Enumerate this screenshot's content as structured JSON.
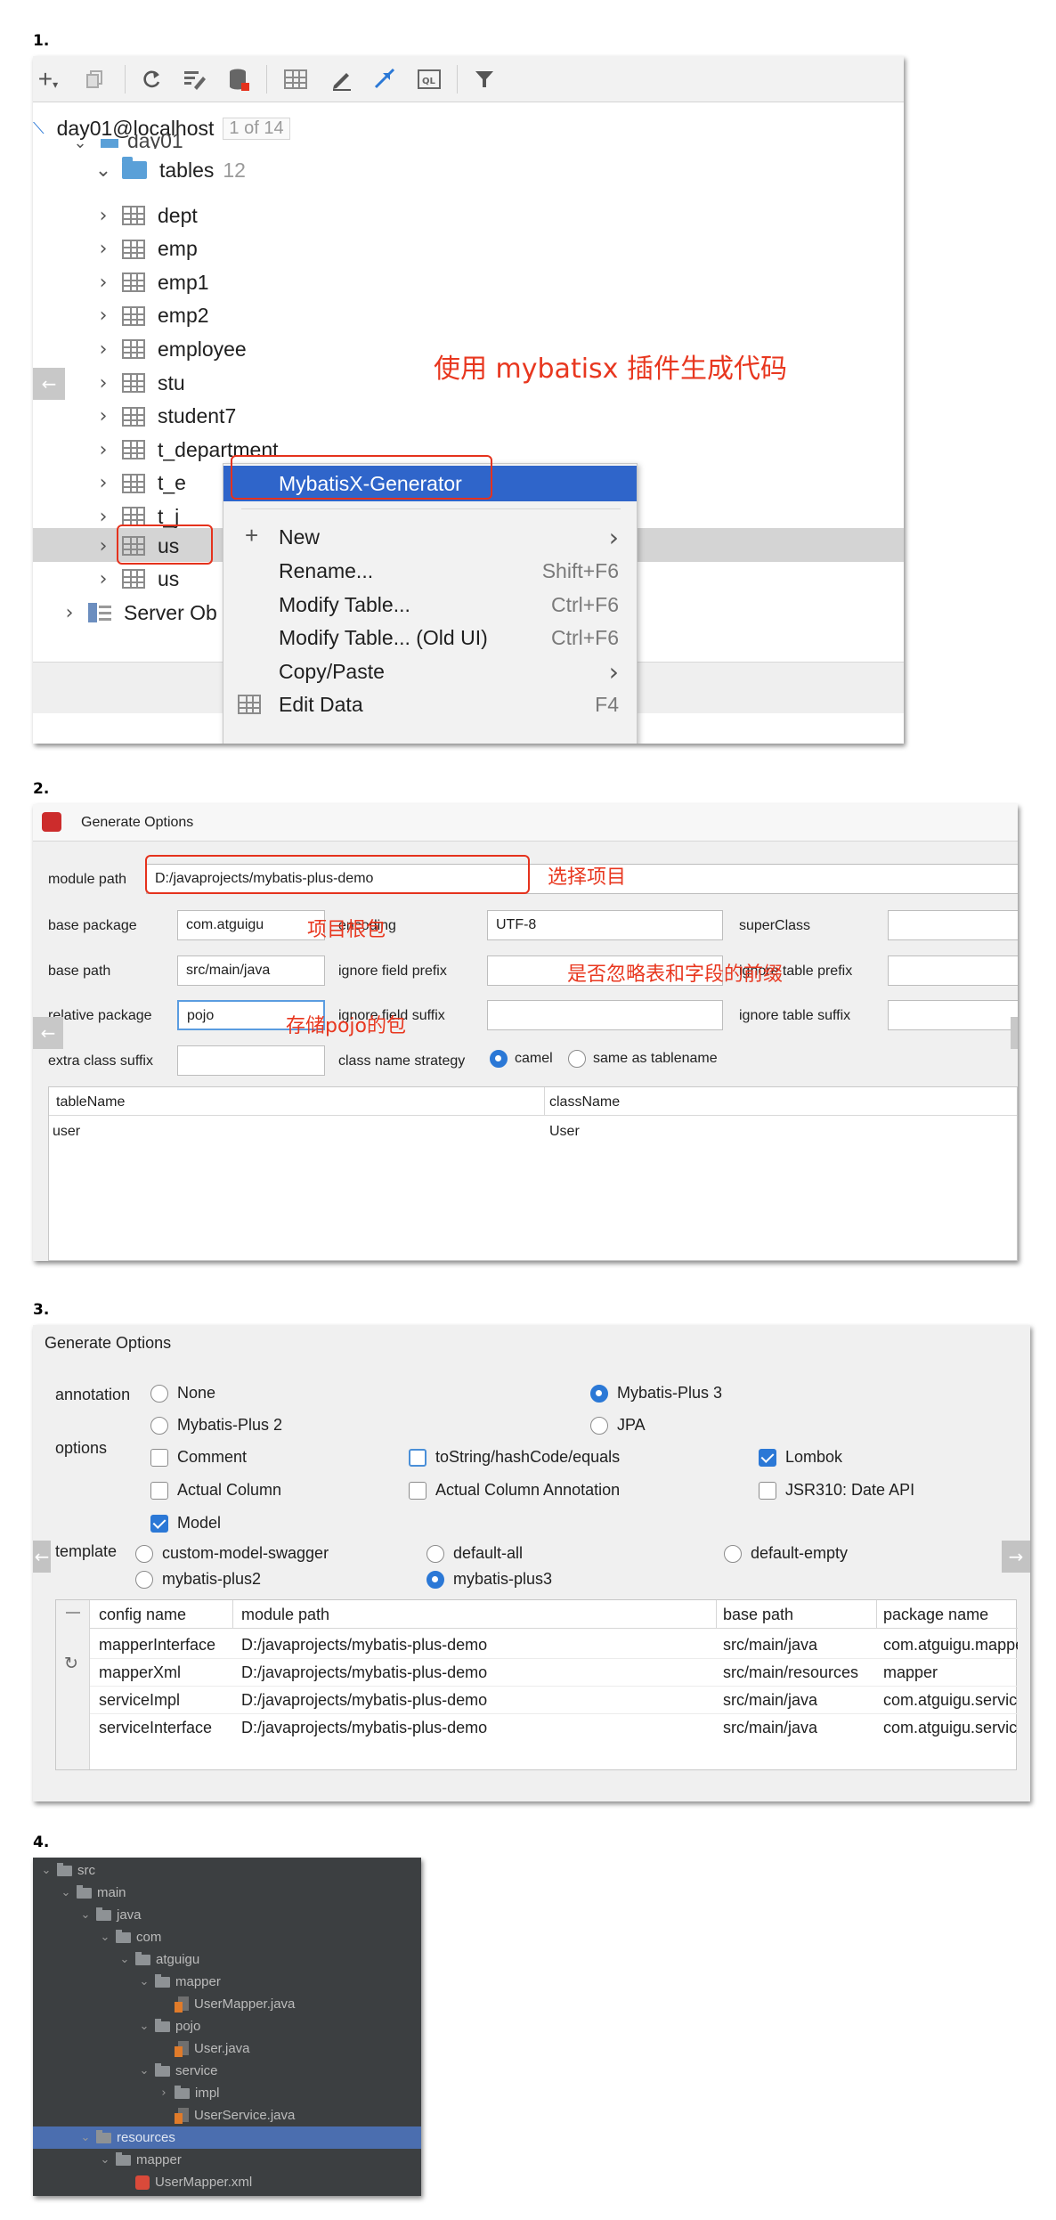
{
  "steps": [
    "1.",
    "2.",
    "3.",
    "4."
  ],
  "panel1": {
    "connection": "day01@localhost",
    "connection_badge": "1 of 14",
    "schema_partial": "day01",
    "tables_folder": "tables",
    "tables_count": "12",
    "tables": [
      "dept",
      "emp",
      "emp1",
      "emp2",
      "employee",
      "stu",
      "student7",
      "t_department",
      "t_e",
      "t_j",
      "us",
      "us"
    ],
    "server_objects": "Server Ob",
    "annotation": "使用 mybatisx 插件生成代码",
    "menu": {
      "generator": "MybatisX-Generator",
      "items": [
        {
          "label": "New",
          "shortcut": "›"
        },
        {
          "label": "Rename...",
          "shortcut": "Shift+F6"
        },
        {
          "label": "Modify Table...",
          "shortcut": "Ctrl+F6"
        },
        {
          "label": "Modify Table... (Old UI)",
          "shortcut": "Ctrl+F6"
        },
        {
          "label": "Copy/Paste",
          "shortcut": "›"
        },
        {
          "label": "Edit Data",
          "shortcut": "F4"
        }
      ]
    },
    "toolbar_icons": [
      "add-icon",
      "duplicate-icon",
      "refresh-icon",
      "edit-schema-icon",
      "database-icon",
      "table-icon",
      "pencil-icon",
      "jump-icon",
      "sql-console-icon",
      "filter-icon"
    ]
  },
  "panel2": {
    "title": "Generate Options",
    "module_path_label": "module path",
    "module_path_value": "D:/javaprojects/mybatis-plus-demo",
    "base_package_label": "base package",
    "base_package_value": "com.atguigu",
    "encoding_label": "encoding",
    "encoding_value": "UTF-8",
    "superclass_label": "superClass",
    "base_path_label": "base path",
    "base_path_value": "src/main/java",
    "ignore_field_prefix_label": "ignore field prefix",
    "ignore_table_prefix_label": "ignore table prefix",
    "relative_package_label": "relative package",
    "relative_package_value": "pojo",
    "ignore_field_suffix_label": "ignore field suffix",
    "ignore_table_suffix_label": "ignore table suffix",
    "extra_class_suffix_label": "extra class suffix",
    "class_name_strategy_label": "class name strategy",
    "strategy_camel": "camel",
    "strategy_same": "same as tablename",
    "table_headers": [
      "tableName",
      "className"
    ],
    "table_rows": [
      [
        "user",
        "User"
      ]
    ],
    "annotations": {
      "select_project": "选择项目",
      "root_package": "项目根包",
      "ignore_prefix": "是否忽略表和字段的前缀",
      "pojo_package": "存储pojo的包"
    }
  },
  "panel3": {
    "title": "Generate Options",
    "annotation_label": "annotation",
    "annotation_options": [
      "None",
      "Mybatis-Plus 3",
      "Mybatis-Plus 2",
      "JPA"
    ],
    "options_label": "options",
    "options": [
      "Comment",
      "toString/hashCode/equals",
      "Lombok",
      "Actual Column",
      "Actual Column Annotation",
      "JSR310: Date API",
      "Model"
    ],
    "template_label": "template",
    "templates": [
      "custom-model-swagger",
      "default-all",
      "default-empty",
      "mybatis-plus2",
      "mybatis-plus3"
    ],
    "table_headers": [
      "config name",
      "module path",
      "base path",
      "package name"
    ],
    "table_rows": [
      [
        "mapperInterface",
        "D:/javaprojects/mybatis-plus-demo",
        "src/main/java",
        "com.atguigu.mapper"
      ],
      [
        "mapperXml",
        "D:/javaprojects/mybatis-plus-demo",
        "src/main/resources",
        "mapper"
      ],
      [
        "serviceImpl",
        "D:/javaprojects/mybatis-plus-demo",
        "src/main/java",
        "com.atguigu.service"
      ],
      [
        "serviceInterface",
        "D:/javaprojects/mybatis-plus-demo",
        "src/main/java",
        "com.atguigu.service"
      ]
    ]
  },
  "panel4": {
    "tree": [
      "src",
      "main",
      "java",
      "com",
      "atguigu",
      "mapper",
      "UserMapper.java",
      "pojo",
      "User.java",
      "service",
      "impl",
      "UserService.java",
      "resources",
      "mapper",
      "UserMapper.xml"
    ]
  }
}
